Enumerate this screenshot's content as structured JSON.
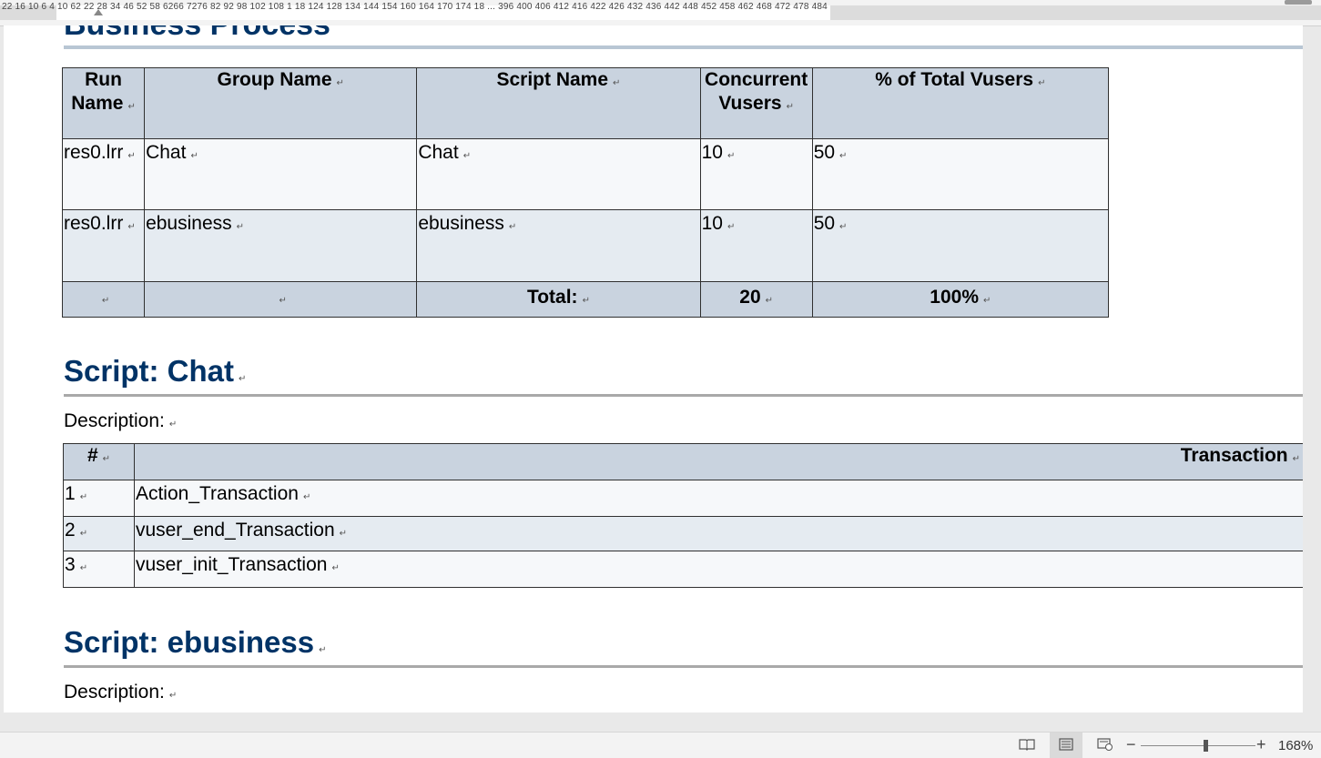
{
  "ruler": {
    "text": "22 16 10 6   4  10  62  22  28  34  46  52  58  6266 7276 82  92 98 102 108 1 18 124 128 134 144 154 160 164 170 174 18 ... 396 400 406 412 416 422 426 432 436 442 448 452 458 462 468 472 478 484"
  },
  "page": {
    "cut_heading": "Business Process",
    "process_table": {
      "headers": [
        "Run Name",
        "Group Name",
        "Script Name",
        "Concurrent Vusers",
        "% of Total Vusers"
      ],
      "rows": [
        [
          "res0.lrr",
          "Chat",
          "Chat",
          "10",
          "50"
        ],
        [
          "res0.lrr",
          "ebusiness",
          "ebusiness",
          "10",
          "50"
        ]
      ],
      "total": {
        "label": "Total:",
        "vusers": "20",
        "percent": "100%"
      }
    },
    "scripts": [
      {
        "heading": "Script: Chat",
        "description_label": "Description:",
        "table": {
          "headers": [
            "#",
            "Transaction"
          ],
          "rows": [
            [
              "1",
              "Action_Transaction"
            ],
            [
              "2",
              "vuser_end_Transaction"
            ],
            [
              "3",
              "vuser_init_Transaction"
            ]
          ]
        }
      },
      {
        "heading": "Script: ebusiness",
        "description_label": "Description:"
      }
    ],
    "paragraph_mark": "↵"
  },
  "statusbar": {
    "zoom_minus": "−",
    "zoom_plus": "+",
    "zoom_level": "168%",
    "icons": [
      "read-mode-icon",
      "print-layout-icon",
      "web-layout-icon"
    ]
  }
}
